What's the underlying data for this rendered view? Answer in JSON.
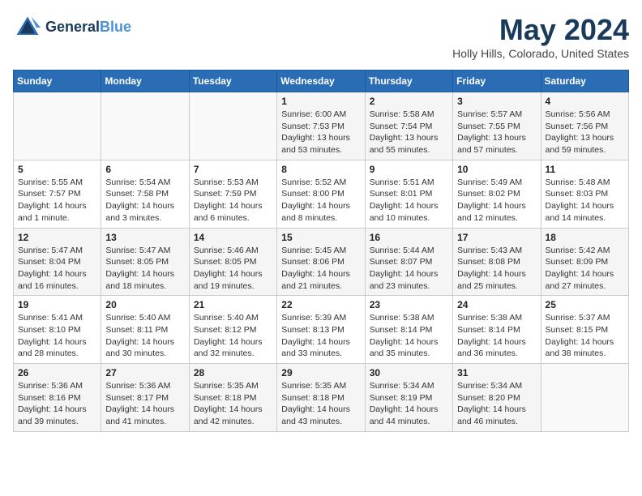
{
  "header": {
    "logo_line1": "General",
    "logo_line2": "Blue",
    "month": "May 2024",
    "location": "Holly Hills, Colorado, United States"
  },
  "weekdays": [
    "Sunday",
    "Monday",
    "Tuesday",
    "Wednesday",
    "Thursday",
    "Friday",
    "Saturday"
  ],
  "weeks": [
    [
      {
        "day": "",
        "info": ""
      },
      {
        "day": "",
        "info": ""
      },
      {
        "day": "",
        "info": ""
      },
      {
        "day": "1",
        "info": "Sunrise: 6:00 AM\nSunset: 7:53 PM\nDaylight: 13 hours\nand 53 minutes."
      },
      {
        "day": "2",
        "info": "Sunrise: 5:58 AM\nSunset: 7:54 PM\nDaylight: 13 hours\nand 55 minutes."
      },
      {
        "day": "3",
        "info": "Sunrise: 5:57 AM\nSunset: 7:55 PM\nDaylight: 13 hours\nand 57 minutes."
      },
      {
        "day": "4",
        "info": "Sunrise: 5:56 AM\nSunset: 7:56 PM\nDaylight: 13 hours\nand 59 minutes."
      }
    ],
    [
      {
        "day": "5",
        "info": "Sunrise: 5:55 AM\nSunset: 7:57 PM\nDaylight: 14 hours\nand 1 minute."
      },
      {
        "day": "6",
        "info": "Sunrise: 5:54 AM\nSunset: 7:58 PM\nDaylight: 14 hours\nand 3 minutes."
      },
      {
        "day": "7",
        "info": "Sunrise: 5:53 AM\nSunset: 7:59 PM\nDaylight: 14 hours\nand 6 minutes."
      },
      {
        "day": "8",
        "info": "Sunrise: 5:52 AM\nSunset: 8:00 PM\nDaylight: 14 hours\nand 8 minutes."
      },
      {
        "day": "9",
        "info": "Sunrise: 5:51 AM\nSunset: 8:01 PM\nDaylight: 14 hours\nand 10 minutes."
      },
      {
        "day": "10",
        "info": "Sunrise: 5:49 AM\nSunset: 8:02 PM\nDaylight: 14 hours\nand 12 minutes."
      },
      {
        "day": "11",
        "info": "Sunrise: 5:48 AM\nSunset: 8:03 PM\nDaylight: 14 hours\nand 14 minutes."
      }
    ],
    [
      {
        "day": "12",
        "info": "Sunrise: 5:47 AM\nSunset: 8:04 PM\nDaylight: 14 hours\nand 16 minutes."
      },
      {
        "day": "13",
        "info": "Sunrise: 5:47 AM\nSunset: 8:05 PM\nDaylight: 14 hours\nand 18 minutes."
      },
      {
        "day": "14",
        "info": "Sunrise: 5:46 AM\nSunset: 8:05 PM\nDaylight: 14 hours\nand 19 minutes."
      },
      {
        "day": "15",
        "info": "Sunrise: 5:45 AM\nSunset: 8:06 PM\nDaylight: 14 hours\nand 21 minutes."
      },
      {
        "day": "16",
        "info": "Sunrise: 5:44 AM\nSunset: 8:07 PM\nDaylight: 14 hours\nand 23 minutes."
      },
      {
        "day": "17",
        "info": "Sunrise: 5:43 AM\nSunset: 8:08 PM\nDaylight: 14 hours\nand 25 minutes."
      },
      {
        "day": "18",
        "info": "Sunrise: 5:42 AM\nSunset: 8:09 PM\nDaylight: 14 hours\nand 27 minutes."
      }
    ],
    [
      {
        "day": "19",
        "info": "Sunrise: 5:41 AM\nSunset: 8:10 PM\nDaylight: 14 hours\nand 28 minutes."
      },
      {
        "day": "20",
        "info": "Sunrise: 5:40 AM\nSunset: 8:11 PM\nDaylight: 14 hours\nand 30 minutes."
      },
      {
        "day": "21",
        "info": "Sunrise: 5:40 AM\nSunset: 8:12 PM\nDaylight: 14 hours\nand 32 minutes."
      },
      {
        "day": "22",
        "info": "Sunrise: 5:39 AM\nSunset: 8:13 PM\nDaylight: 14 hours\nand 33 minutes."
      },
      {
        "day": "23",
        "info": "Sunrise: 5:38 AM\nSunset: 8:14 PM\nDaylight: 14 hours\nand 35 minutes."
      },
      {
        "day": "24",
        "info": "Sunrise: 5:38 AM\nSunset: 8:14 PM\nDaylight: 14 hours\nand 36 minutes."
      },
      {
        "day": "25",
        "info": "Sunrise: 5:37 AM\nSunset: 8:15 PM\nDaylight: 14 hours\nand 38 minutes."
      }
    ],
    [
      {
        "day": "26",
        "info": "Sunrise: 5:36 AM\nSunset: 8:16 PM\nDaylight: 14 hours\nand 39 minutes."
      },
      {
        "day": "27",
        "info": "Sunrise: 5:36 AM\nSunset: 8:17 PM\nDaylight: 14 hours\nand 41 minutes."
      },
      {
        "day": "28",
        "info": "Sunrise: 5:35 AM\nSunset: 8:18 PM\nDaylight: 14 hours\nand 42 minutes."
      },
      {
        "day": "29",
        "info": "Sunrise: 5:35 AM\nSunset: 8:18 PM\nDaylight: 14 hours\nand 43 minutes."
      },
      {
        "day": "30",
        "info": "Sunrise: 5:34 AM\nSunset: 8:19 PM\nDaylight: 14 hours\nand 44 minutes."
      },
      {
        "day": "31",
        "info": "Sunrise: 5:34 AM\nSunset: 8:20 PM\nDaylight: 14 hours\nand 46 minutes."
      },
      {
        "day": "",
        "info": ""
      }
    ]
  ]
}
